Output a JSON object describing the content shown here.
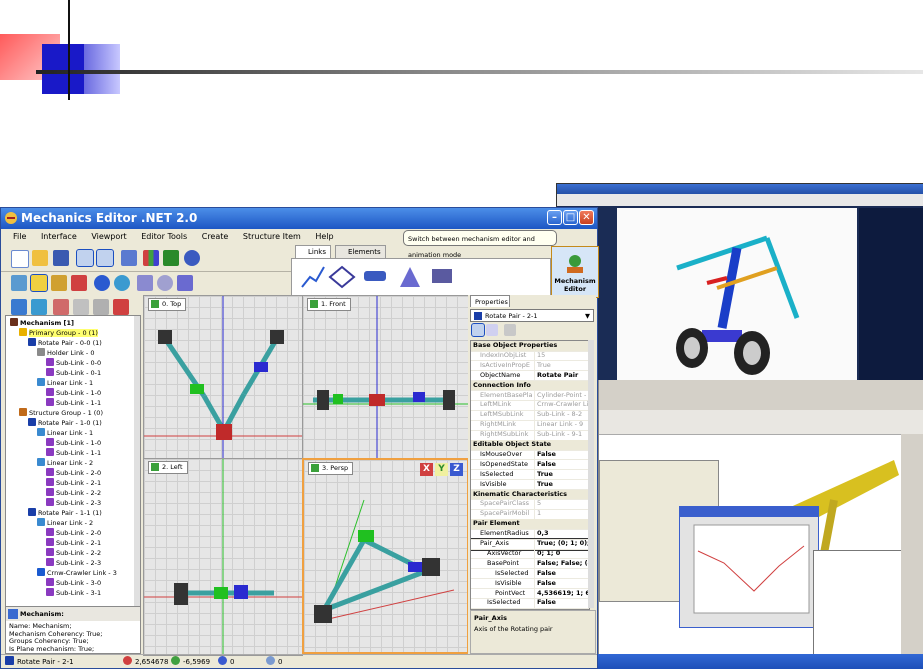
{
  "colors": {
    "title_bar": "#1d56c4",
    "highlight": "#ffff70",
    "persp_border": "#f0a040"
  },
  "window": {
    "title": "Mechanics Editor .NET 2.0"
  },
  "menu": [
    "File",
    "Interface",
    "Viewport",
    "Editor Tools",
    "Create",
    "Structure Item",
    "Help"
  ],
  "ribbon": {
    "tabs": [
      "Links",
      "Elements"
    ]
  },
  "tooltip": "Switch between mechanism editor and animation mode",
  "mechanism_button": {
    "label_line1": "Mechanism",
    "label_line2": "Editor"
  },
  "tree": [
    {
      "indent": 0,
      "label": "Mechanism [1]",
      "icon": "mechanism-icon",
      "color": "#6a2f1a",
      "bold": true
    },
    {
      "indent": 1,
      "label": "Primary Group - 0 (1)",
      "icon": "group-icon",
      "color": "#e8b000",
      "hl": true
    },
    {
      "indent": 2,
      "label": "Rotate Pair - 0-0 (1)",
      "icon": "pair-icon",
      "color": "#1a3ea8"
    },
    {
      "indent": 3,
      "label": "Holder Link - 0",
      "icon": "holder-link-icon",
      "color": "#8a8a8a"
    },
    {
      "indent": 4,
      "label": "Sub-Link - 0-0",
      "icon": "sublink-icon",
      "color": "#8a3ac0"
    },
    {
      "indent": 4,
      "label": "Sub-Link - 0-1",
      "icon": "sublink-icon",
      "color": "#8a3ac0"
    },
    {
      "indent": 3,
      "label": "Linear Link - 1",
      "icon": "linear-link-icon",
      "color": "#3a8ad0"
    },
    {
      "indent": 4,
      "label": "Sub-Link - 1-0",
      "icon": "sublink-icon",
      "color": "#8a3ac0"
    },
    {
      "indent": 4,
      "label": "Sub-Link - 1-1",
      "icon": "sublink-icon",
      "color": "#8a3ac0"
    },
    {
      "indent": 1,
      "label": "Structure Group - 1 (0)",
      "icon": "group-icon",
      "color": "#c06a1a"
    },
    {
      "indent": 2,
      "label": "Rotate Pair - 1-0 (1)",
      "icon": "pair-icon",
      "color": "#1a3ea8"
    },
    {
      "indent": 3,
      "label": "Linear Link - 1",
      "icon": "linear-link-icon",
      "color": "#3a8ad0"
    },
    {
      "indent": 4,
      "label": "Sub-Link - 1-0",
      "icon": "sublink-icon",
      "color": "#8a3ac0"
    },
    {
      "indent": 4,
      "label": "Sub-Link - 1-1",
      "icon": "sublink-icon",
      "color": "#8a3ac0"
    },
    {
      "indent": 3,
      "label": "Linear Link - 2",
      "icon": "linear-link-icon",
      "color": "#3a8ad0"
    },
    {
      "indent": 4,
      "label": "Sub-Link - 2-0",
      "icon": "sublink-icon",
      "color": "#8a3ac0"
    },
    {
      "indent": 4,
      "label": "Sub-Link - 2-1",
      "icon": "sublink-icon",
      "color": "#8a3ac0"
    },
    {
      "indent": 4,
      "label": "Sub-Link - 2-2",
      "icon": "sublink-icon",
      "color": "#8a3ac0"
    },
    {
      "indent": 4,
      "label": "Sub-Link - 2-3",
      "icon": "sublink-icon",
      "color": "#8a3ac0"
    },
    {
      "indent": 2,
      "label": "Rotate Pair - 1-1 (1)",
      "icon": "pair-icon",
      "color": "#1a3ea8"
    },
    {
      "indent": 3,
      "label": "Linear Link - 2",
      "icon": "linear-link-icon",
      "color": "#3a8ad0"
    },
    {
      "indent": 4,
      "label": "Sub-Link - 2-0",
      "icon": "sublink-icon",
      "color": "#8a3ac0"
    },
    {
      "indent": 4,
      "label": "Sub-Link - 2-1",
      "icon": "sublink-icon",
      "color": "#8a3ac0"
    },
    {
      "indent": 4,
      "label": "Sub-Link - 2-2",
      "icon": "sublink-icon",
      "color": "#8a3ac0"
    },
    {
      "indent": 4,
      "label": "Sub-Link - 2-3",
      "icon": "sublink-icon",
      "color": "#8a3ac0"
    },
    {
      "indent": 3,
      "label": "Crnw-Crawler Link - 3",
      "icon": "crawler-link-icon",
      "color": "#1a5ad0"
    },
    {
      "indent": 4,
      "label": "Sub-Link - 3-0",
      "icon": "sublink-icon",
      "color": "#8a3ac0"
    },
    {
      "indent": 4,
      "label": "Sub-Link - 3-1",
      "icon": "sublink-icon",
      "color": "#8a3ac0"
    }
  ],
  "description": {
    "header": "Mechanism:",
    "lines": [
      "Name: Mechanism;",
      "Mechanism Coherency: True;",
      "Groups Coherency: True;",
      "Is Plane mechanism: True;"
    ]
  },
  "viewports": {
    "top": "0. Top",
    "front": "1. Front",
    "left": "2. Left",
    "persp": "3. Persp",
    "axes": [
      "X",
      "Y",
      "Z"
    ]
  },
  "properties": {
    "tab": "Properties",
    "selected": "Rotate Pair - 2-1",
    "rows": [
      {
        "t": "cat",
        "k": "Base Object Properties"
      },
      {
        "t": "ro",
        "k": "IndexInObjList",
        "v": "15"
      },
      {
        "t": "ro",
        "k": "IsActiveInPropE",
        "v": "True"
      },
      {
        "t": "kv",
        "k": "ObjectName",
        "v": "Rotate Pair"
      },
      {
        "t": "cat",
        "k": "Connection Info"
      },
      {
        "t": "ro",
        "k": "ElementBasePla",
        "v": "Cylinder-Point - 10"
      },
      {
        "t": "ro",
        "k": "LeftMLink",
        "v": "Crnw-Crawler Link"
      },
      {
        "t": "ro",
        "k": "LeftMSubLink",
        "v": "Sub-Link - 8-2"
      },
      {
        "t": "ro",
        "k": "RightMLink",
        "v": "Linear Link - 9"
      },
      {
        "t": "ro",
        "k": "RightMSubLink",
        "v": "Sub-Link - 9-1"
      },
      {
        "t": "cat",
        "k": "Editable Object State"
      },
      {
        "t": "kv",
        "k": "IsMouseOver",
        "v": "False"
      },
      {
        "t": "kv",
        "k": "IsOpenedState",
        "v": "False"
      },
      {
        "t": "kv",
        "k": "IsSelected",
        "v": "True"
      },
      {
        "t": "kv",
        "k": "IsVisible",
        "v": "True"
      },
      {
        "t": "cat",
        "k": "Kinematic Characteristics"
      },
      {
        "t": "ro",
        "k": "SpacePairClass",
        "v": "5"
      },
      {
        "t": "ro",
        "k": "SpacePairMobil",
        "v": "1"
      },
      {
        "t": "cat",
        "k": "Pair Element"
      },
      {
        "t": "kv",
        "k": "ElementRadius",
        "v": "0,3"
      },
      {
        "t": "sel",
        "k": "Pair_Axis",
        "v": "True; (0; 1; 0); ("
      },
      {
        "t": "kv2",
        "k": "AxisVector",
        "v": "0; 1; 0"
      },
      {
        "t": "kv2",
        "k": "BasePoint",
        "v": "False; False; (4,"
      },
      {
        "t": "kv3",
        "k": "IsSelected",
        "v": "False"
      },
      {
        "t": "kv3",
        "k": "IsVisible",
        "v": "False"
      },
      {
        "t": "kv3",
        "k": "PointVect",
        "v": "4,536619; 1; 6,6"
      },
      {
        "t": "kv2",
        "k": "IsSelected",
        "v": "False"
      }
    ],
    "help_title": "Pair_Axis",
    "help_text": "Axis of the Rotating pair"
  },
  "status": {
    "selection": "Rotate Pair - 2-1",
    "x": "2,654678",
    "y": "-6,5969",
    "z": "0",
    "t": "0"
  }
}
